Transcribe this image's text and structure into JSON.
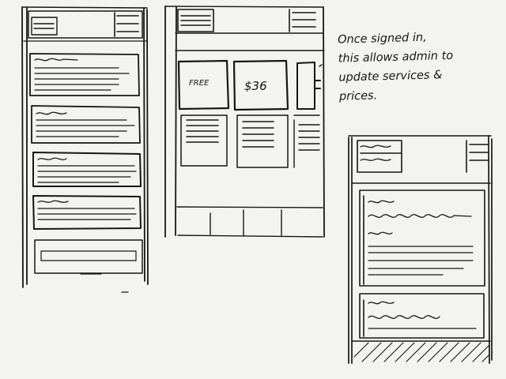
{
  "annotation": {
    "lines": [
      "Once signed in,",
      "this allows admin to",
      "update services &",
      "prices."
    ]
  },
  "pricing_cards": [
    {
      "label": "FREE"
    },
    {
      "label": "$36"
    }
  ]
}
